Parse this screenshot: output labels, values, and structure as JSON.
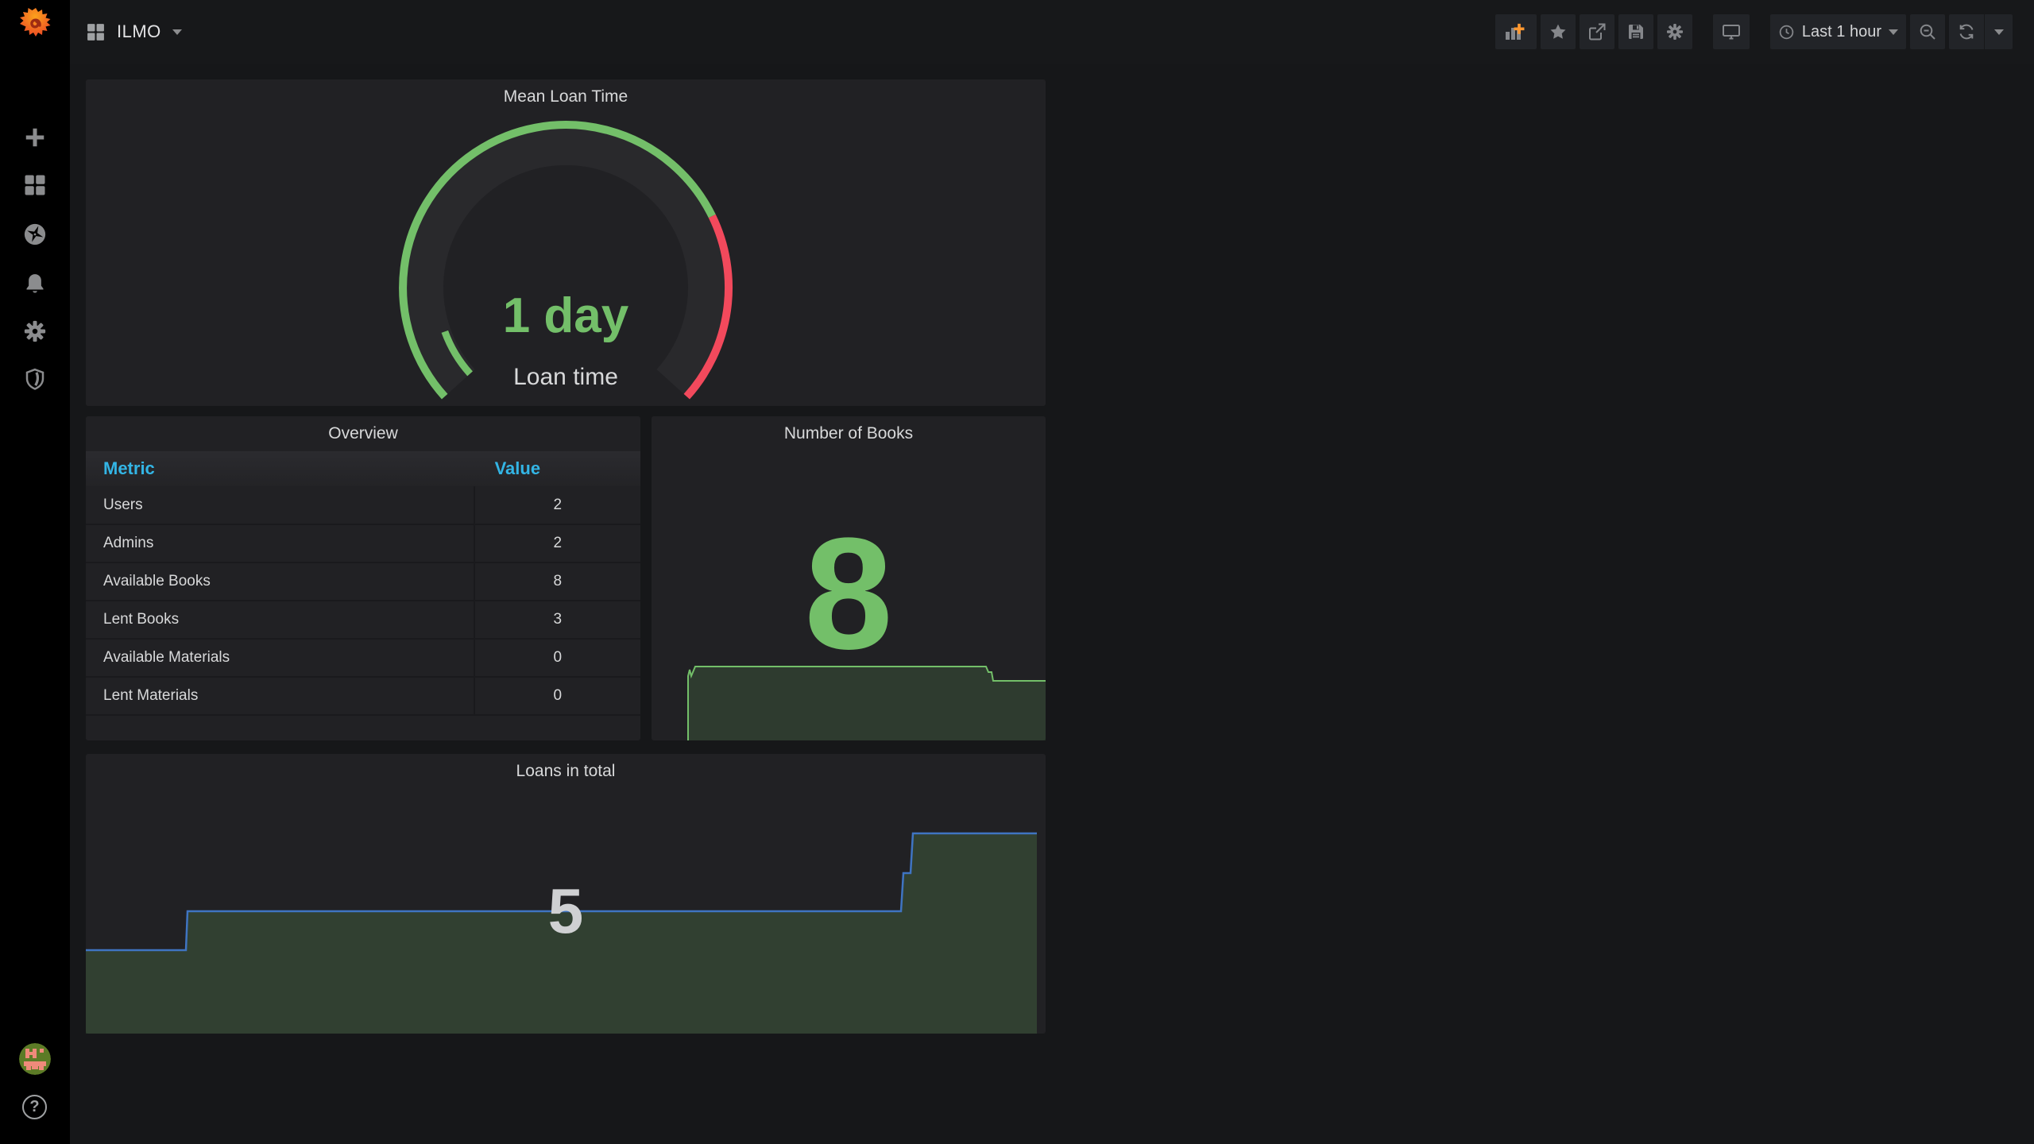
{
  "app": "Grafana dashboard",
  "colors": {
    "page_bg": "#161719",
    "panel_bg": "#212124",
    "sidebar_bg": "#000000",
    "green": "#73BF69",
    "red": "#F2495C",
    "blue_line": "#3F74C2",
    "table_header_blue": "#33B5E5",
    "text": "#D8D9DA",
    "add_panel_plus_orange": "#FF9830"
  },
  "sidebar": {
    "icons": [
      {
        "name": "grafana-logo"
      },
      {
        "name": "create-plus-icon"
      },
      {
        "name": "dashboards-icon"
      },
      {
        "name": "explore-compass-icon"
      },
      {
        "name": "alerting-bell-icon"
      },
      {
        "name": "configuration-gear-icon"
      },
      {
        "name": "server-admin-shield-icon"
      },
      {
        "name": "user-avatar"
      },
      {
        "name": "help-icon"
      }
    ],
    "help_glyph": "?"
  },
  "navbar": {
    "title": "ILMO",
    "left_icons": [
      "dashboard-grid-icon",
      "dropdown-caret"
    ],
    "buttons": [
      "add-panel",
      "star",
      "share",
      "save",
      "settings",
      "tv-mode"
    ],
    "time_range": "Last 1 hour",
    "time_buttons": [
      "zoom-out",
      "refresh",
      "refresh-interval-caret"
    ]
  },
  "panels": {
    "gauge": {
      "title": "Mean Loan Time",
      "value": "1 day",
      "label": "Loan time"
    },
    "table": {
      "title": "Overview",
      "col_metric": "Metric",
      "col_value": "Value",
      "rows": [
        {
          "metric": "Users",
          "value": "2"
        },
        {
          "metric": "Admins",
          "value": "2"
        },
        {
          "metric": "Available Books",
          "value": "8"
        },
        {
          "metric": "Lent Books",
          "value": "3"
        },
        {
          "metric": "Available Materials",
          "value": "0"
        },
        {
          "metric": "Lent Materials",
          "value": "0"
        }
      ]
    },
    "books": {
      "title": "Number of Books",
      "value": "8"
    },
    "loans": {
      "title": "Loans in total",
      "value": "5"
    }
  },
  "chart_data": [
    {
      "type": "gauge",
      "title": "Mean Loan Time",
      "value_text": "1 day",
      "value_days": 1,
      "label": "Loan time",
      "segments": [
        {
          "color": "#73BF69",
          "fraction": 0.73
        },
        {
          "color": "#F2495C",
          "fraction": 0.27
        }
      ],
      "sweep_degrees": 270
    },
    {
      "type": "table",
      "title": "Overview",
      "columns": [
        "Metric",
        "Value"
      ],
      "rows": [
        [
          "Users",
          2
        ],
        [
          "Admins",
          2
        ],
        [
          "Available Books",
          8
        ],
        [
          "Lent Books",
          3
        ],
        [
          "Available Materials",
          0
        ],
        [
          "Lent Materials",
          0
        ]
      ]
    },
    {
      "type": "area",
      "title": "Number of Books",
      "current": 8,
      "x_axis": "time (Last 1 hour, no axis labels shown)",
      "estimated": true,
      "values": [
        0,
        8,
        8,
        8,
        8,
        8,
        8,
        7,
        7
      ],
      "line_color": "#73BF69",
      "fill": "dark translucent green"
    },
    {
      "type": "area",
      "title": "Loans in total",
      "current": 5,
      "x_axis": "time (Last 1 hour, no axis labels shown)",
      "estimated": true,
      "values": [
        3,
        4,
        4,
        4,
        4,
        4,
        5,
        6,
        6
      ],
      "line_color": "#3F74C2",
      "fill": "dark translucent green"
    }
  ]
}
